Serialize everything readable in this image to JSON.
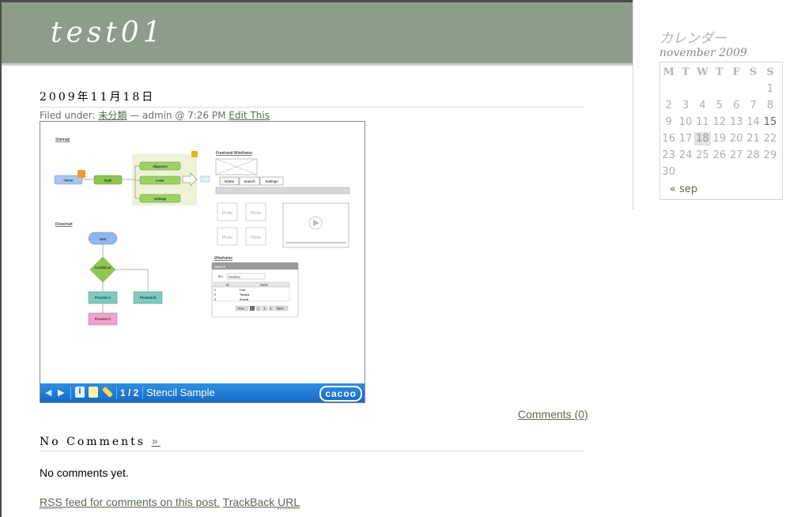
{
  "site": {
    "title": "test01"
  },
  "post": {
    "date": "2009年11月18日",
    "meta": {
      "filed_under": "Filed under:",
      "category": "未分類",
      "byline": "— admin @ 7:26 PM",
      "edit": "Edit This"
    },
    "embed": {
      "prev_icon": "triangle-left-icon",
      "next_icon": "triangle-right-icon",
      "info_icon": "info-icon",
      "page": "1 / 2",
      "title": "Stencil Sample",
      "logo": "cacoo",
      "diagram": {
        "sitemap": {
          "heading": "Sitemap",
          "nodes": [
            "Home",
            "login",
            "diagrams",
            "invite",
            "settings"
          ]
        },
        "flowchart": {
          "heading": "Flowchart",
          "nodes": [
            "start",
            "Conditi on",
            "Process A",
            "Process B",
            "Process C"
          ]
        },
        "freehand": {
          "heading": "Freehand Wireframe",
          "tabs": [
            "Home",
            "Search",
            "Settings"
          ],
          "photo": "Photo"
        },
        "wireframe": {
          "heading": "Wireframe",
          "panel_title": "Search",
          "select_label": "ID=",
          "select_value": "Desktop",
          "columns": [
            "ID",
            "Name"
          ],
          "rows": [
            [
              "1",
              "Lisa"
            ],
            [
              "2",
              "Tanaka"
            ],
            [
              "3",
              "Suzuki"
            ]
          ],
          "pager": [
            "<Prev",
            "1",
            "2",
            "3",
            "4",
            "Next>"
          ]
        }
      }
    },
    "comments_link": "Comments (0)"
  },
  "comments": {
    "heading": "No Comments",
    "heading_link": "»",
    "empty": "No comments yet.",
    "rss_abbr": "RSS",
    "rss_text": " feed for comments on this post.",
    "trackback": "TrackBack ",
    "trackback_abbr": "URL"
  },
  "sidebar": {
    "title": "カレンダー",
    "caption": "november 2009",
    "weekdays": [
      "M",
      "T",
      "W",
      "T",
      "F",
      "S",
      "S"
    ],
    "weeks": [
      [
        "",
        "",
        "",
        "",
        "",
        "",
        "1"
      ],
      [
        "2",
        "3",
        "4",
        "5",
        "6",
        "7",
        "8"
      ],
      [
        "9",
        "10",
        "11",
        "12",
        "13",
        "14",
        "15"
      ],
      [
        "16",
        "17",
        "18",
        "19",
        "20",
        "21",
        "22"
      ],
      [
        "23",
        "24",
        "25",
        "26",
        "27",
        "28",
        "29"
      ],
      [
        "30",
        "",
        "",
        "",
        "",
        "",
        ""
      ]
    ],
    "linked_day": "15",
    "today": "18",
    "prev_link": "« sep"
  },
  "colors": {
    "header": "#8e9c8b",
    "link": "#5b6a55",
    "toolbar": "#1f7ad4"
  }
}
